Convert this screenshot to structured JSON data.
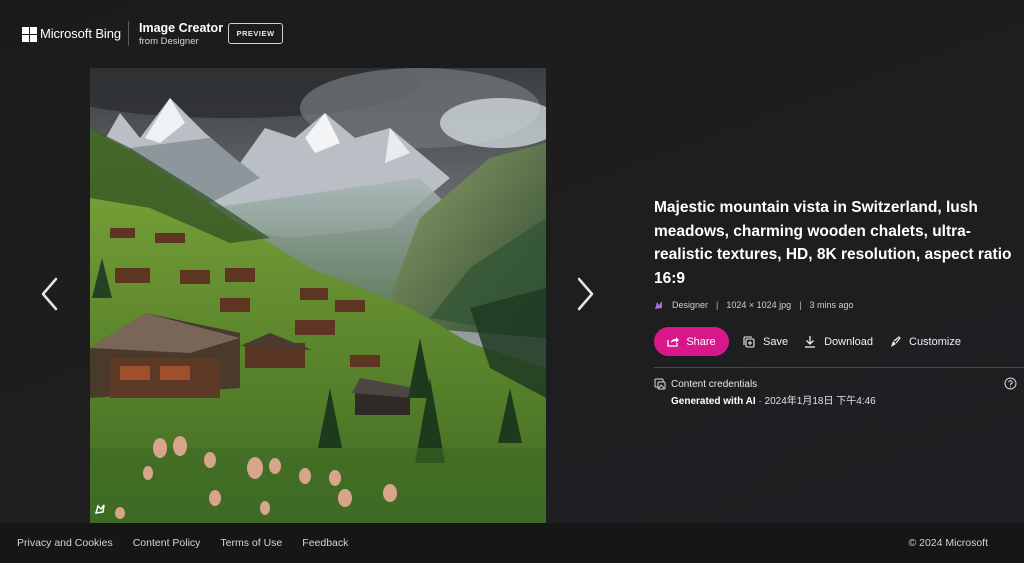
{
  "header": {
    "brand": "Microsoft Bing",
    "product_title": "Image Creator",
    "product_subtitle": "from Designer",
    "preview_label": "PREVIEW"
  },
  "image": {
    "alt": "Majestic mountain vista in Switzerland with lush meadows and wooden chalets",
    "badge_icon": "designer-icon"
  },
  "navigation": {
    "prev_icon": "chevron-left-icon",
    "next_icon": "chevron-right-icon"
  },
  "details": {
    "prompt": "Majestic mountain vista in Switzerland, lush meadows, charming wooden chalets, ultra-realistic textures, HD, 8K resolution, aspect ratio 16:9",
    "source": "Designer",
    "dimensions": "1024 × 1024 jpg",
    "time_ago": "3 mins ago",
    "separator": "|"
  },
  "actions": {
    "share": "Share",
    "save": "Save",
    "download": "Download",
    "customize": "Customize",
    "share_color": "#d7178a"
  },
  "credentials": {
    "title": "Content credentials",
    "generated_label": "Generated with AI",
    "date_text": " · 2024年1月18日 下午4:46"
  },
  "footer": {
    "links": [
      "Privacy and Cookies",
      "Content Policy",
      "Terms of Use",
      "Feedback"
    ],
    "copyright": "© 2024 Microsoft"
  }
}
